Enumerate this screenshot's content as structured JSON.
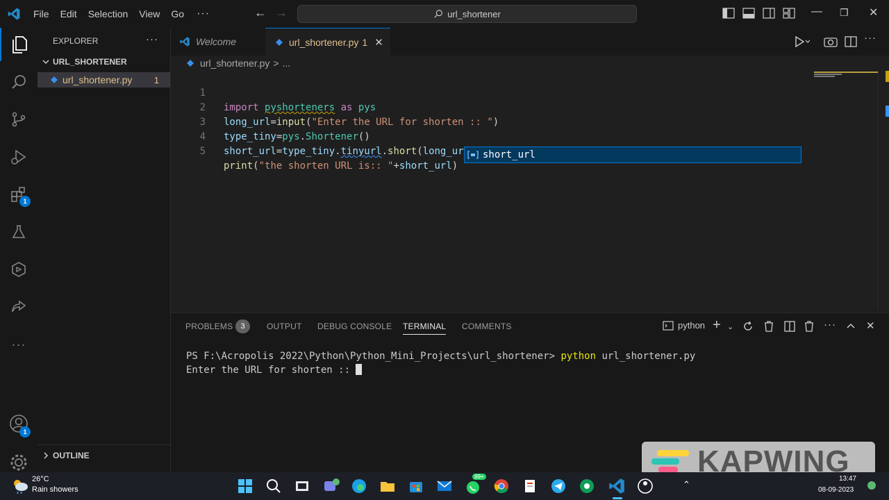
{
  "menubar": {
    "items": [
      "File",
      "Edit",
      "Selection",
      "View",
      "Go"
    ],
    "more": "···"
  },
  "command_center": {
    "text": "url_shortener"
  },
  "sidebar": {
    "title": "EXPLORER",
    "more": "···",
    "folder": "URL_SHORTENER",
    "file": {
      "name": "url_shortener.py",
      "problems": "1"
    },
    "outline": "OUTLINE"
  },
  "activity": {
    "extensions_badge": "1",
    "accounts_badge": "1",
    "more": "···"
  },
  "tabs": {
    "welcome": "Welcome",
    "active": "url_shortener.py",
    "active_count": "1"
  },
  "breadcrumb": {
    "file": "url_shortener.py",
    "sep": ">",
    "rest": "..."
  },
  "editor": {
    "line_numbers": [
      "1",
      "2",
      "3",
      "4",
      "5"
    ],
    "suggestion": "short_url"
  },
  "panel": {
    "tabs": {
      "problems": "PROBLEMS",
      "problems_count": "3",
      "output": "OUTPUT",
      "debug": "DEBUG CONSOLE",
      "terminal": "TERMINAL",
      "comments": "COMMENTS"
    },
    "shell": "python",
    "terminal": {
      "prompt": "PS F:\\Acropolis 2022\\Python\\Python_Mini_Projects\\url_shortener> ",
      "cmd": "python",
      "args": " url_shortener.py",
      "output": "Enter the URL for shorten :: "
    }
  },
  "watermark": {
    "text": "KAPWING"
  },
  "taskbar": {
    "temp": "26°C",
    "weather": "Rain showers",
    "time": "13:47",
    "date": "08-09-2023",
    "whatsapp_badge": "99+"
  },
  "colors": {
    "accent": "#0078d4",
    "modified_file": "#e2c08d",
    "keyword": "#c586c0",
    "variable": "#9cdcfe",
    "function": "#dcdcaa",
    "string": "#ce9178"
  }
}
